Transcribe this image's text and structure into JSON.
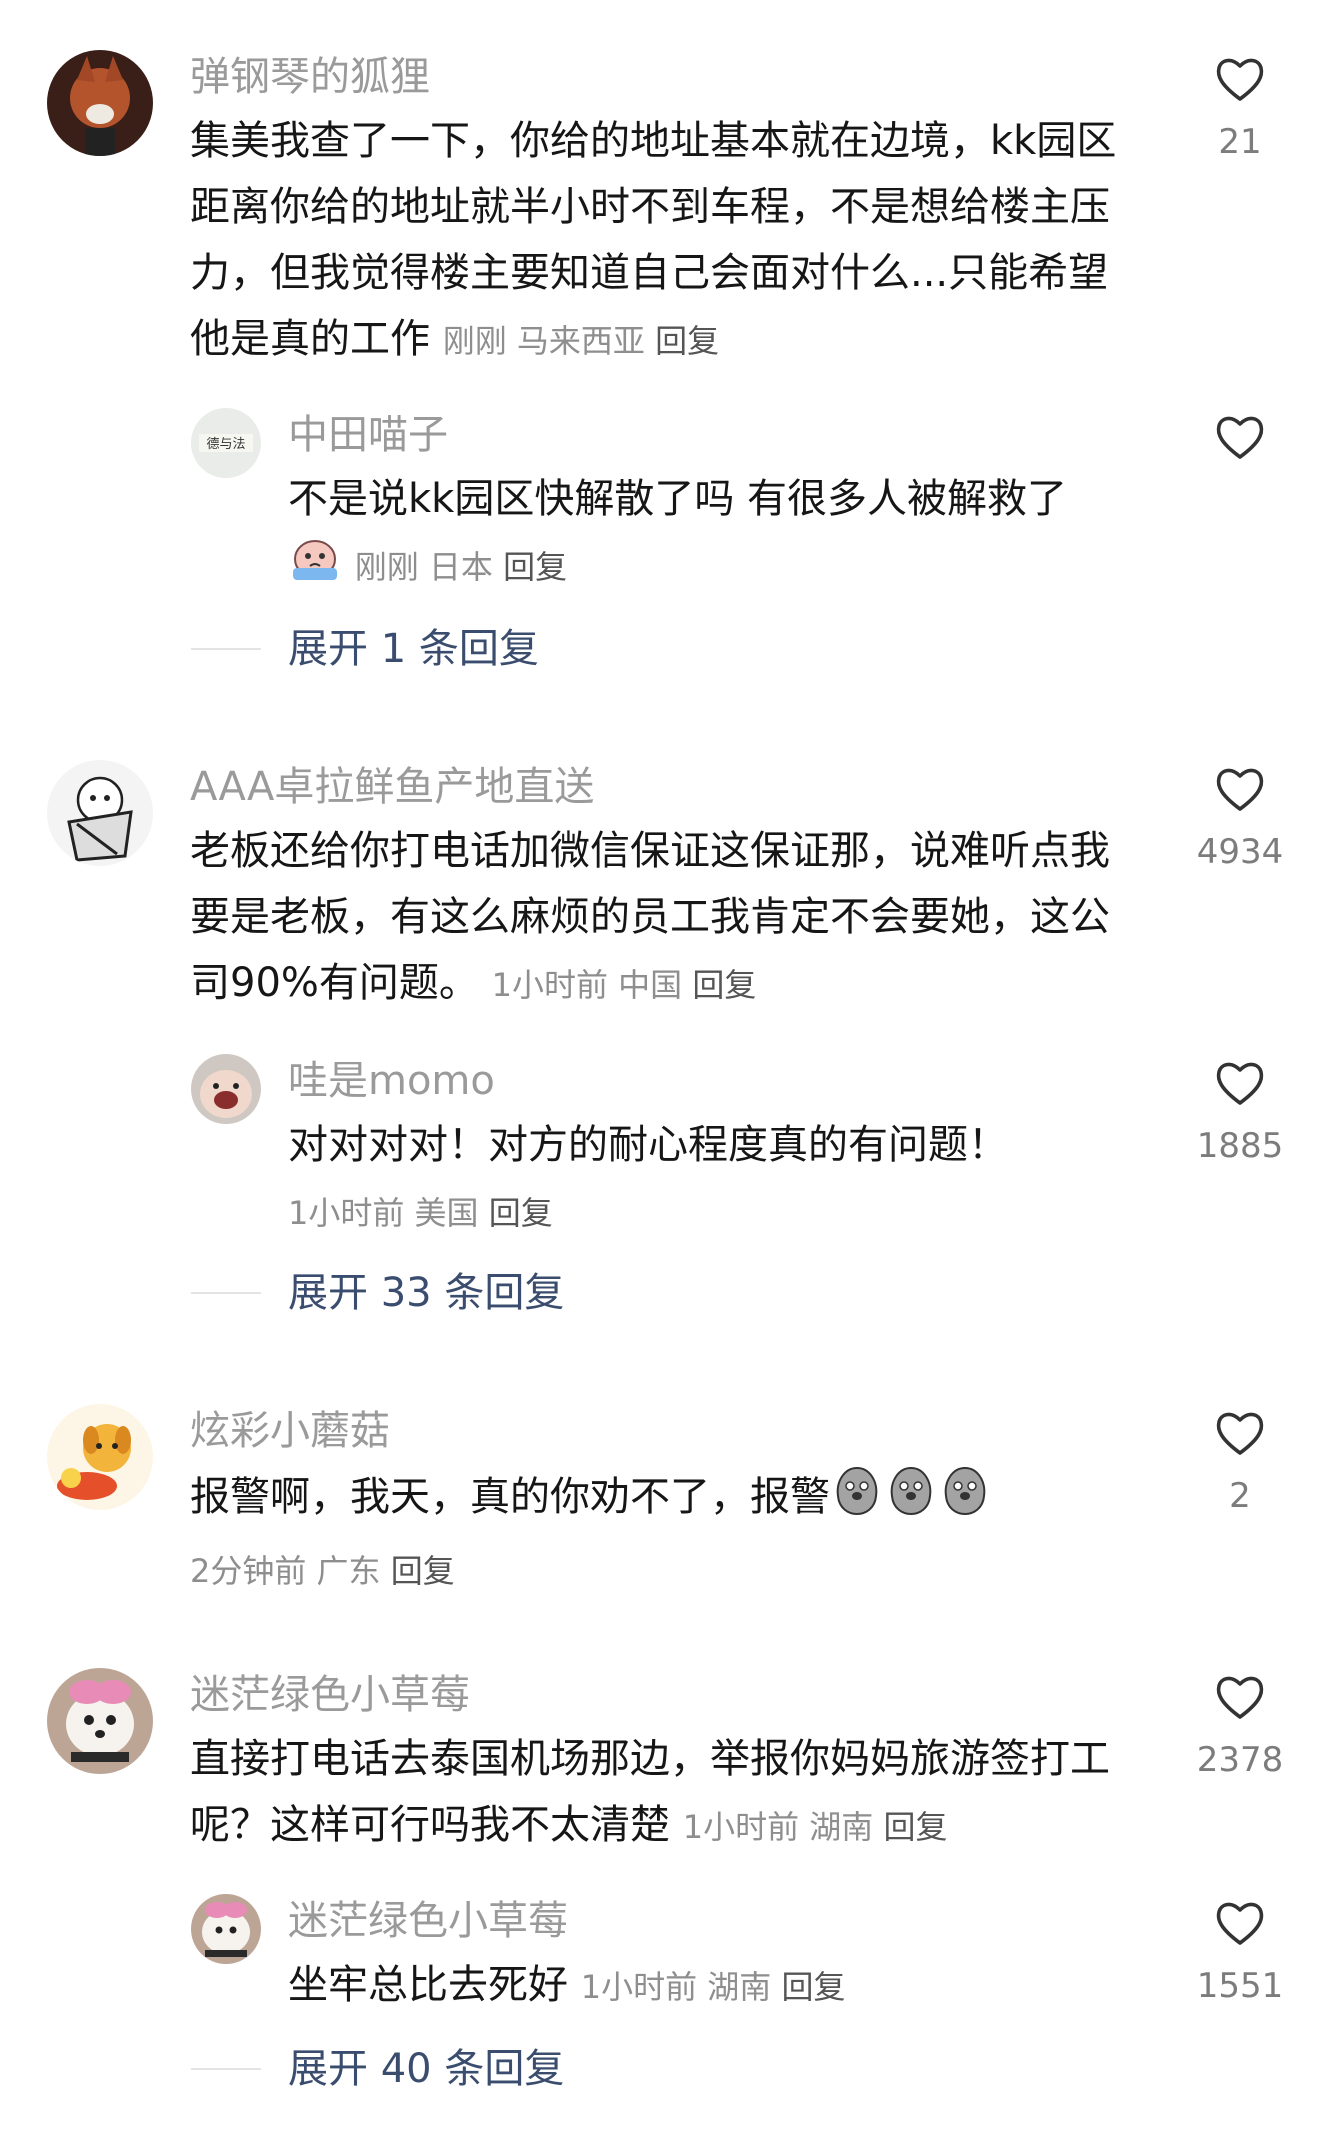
{
  "colors": {
    "username": "#9a9a9a",
    "text": "#161616",
    "meta": "#8e8e8e",
    "expand": "#3b4d6e",
    "heart_outline": "#333333"
  },
  "comments": [
    {
      "username": "弹钢琴的狐狸",
      "lines": [
        "集美我查了一下，你给的地址基本就在边境，kk园区",
        "距离你给的地址就半小时不到车程，不是想给楼主压",
        "力，但我觉得楼主要知道自己会面对什么...只能希望",
        "他是真的工作"
      ],
      "time": "刚刚",
      "location": "马来西亚",
      "reply": "回复",
      "likes": "21",
      "replies": [
        {
          "username": "中田喵子",
          "lines": [
            "不是说kk园区快解散了吗 有很多人被解救了"
          ],
          "time": "刚刚",
          "location": "日本",
          "reply": "回复",
          "likes": ""
        }
      ],
      "expand": "展开 1 条回复"
    },
    {
      "username": "AAA卓拉鲜鱼产地直送",
      "lines": [
        "老板还给你打电话加微信保证这保证那，说难听点我",
        "要是老板，有这么麻烦的员工我肯定不会要她，这公",
        "司90%有问题。"
      ],
      "time": "1小时前",
      "location": "中国",
      "reply": "回复",
      "likes": "4934",
      "replies": [
        {
          "username": "哇是momo",
          "lines": [
            "对对对对！对方的耐心程度真的有问题！"
          ],
          "time": "1小时前",
          "location": "美国",
          "reply": "回复",
          "likes": "1885"
        }
      ],
      "expand": "展开 33 条回复"
    },
    {
      "username": "炫彩小蘑菇",
      "lines": [
        "报警啊，我天，真的你劝不了，报警"
      ],
      "time": "2分钟前",
      "location": "广东",
      "reply": "回复",
      "likes": "2"
    },
    {
      "username": "迷茫绿色小草莓",
      "lines": [
        "直接打电话去泰国机场那边，举报你妈妈旅游签打工",
        "呢？这样可行吗我不太清楚"
      ],
      "time": "1小时前",
      "location": "湖南",
      "reply": "回复",
      "likes": "2378",
      "replies": [
        {
          "username": "迷茫绿色小草莓",
          "lines": [
            "坐牢总比去死好"
          ],
          "time": "1小时前",
          "location": "湖南",
          "reply": "回复",
          "likes": "1551"
        }
      ],
      "expand": "展开 40 条回复"
    }
  ],
  "icons": {
    "like": "heart-outline-icon",
    "sticker": "crying-emoji-icon",
    "pigeon": "pigeon-emoji-icon"
  }
}
